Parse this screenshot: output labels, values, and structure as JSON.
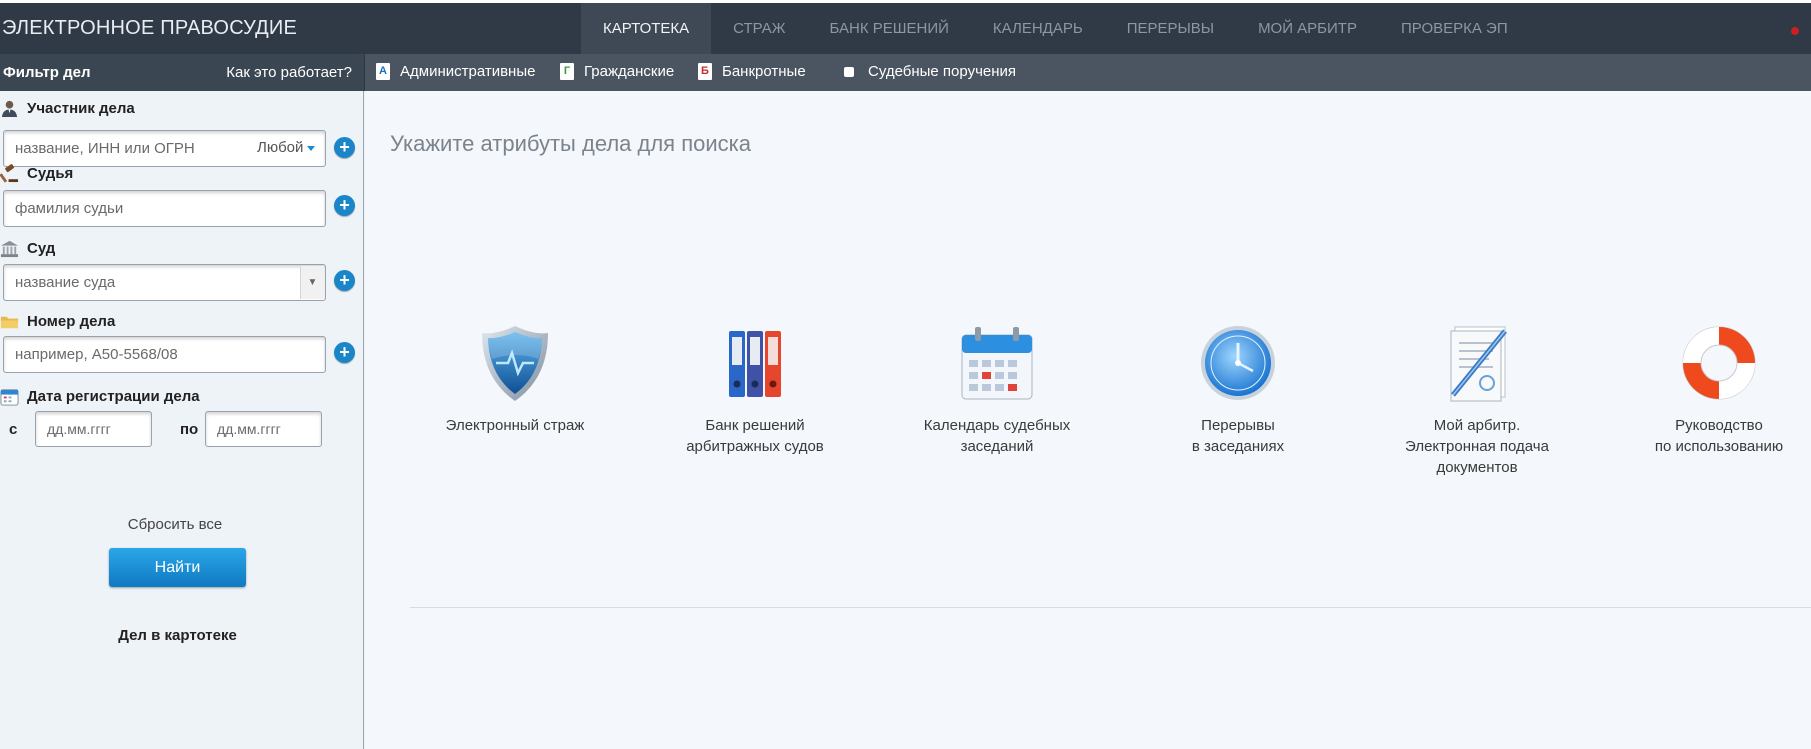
{
  "header": {
    "brand": "ЭЛЕКТРОННОЕ ПРАВОСУДИЕ",
    "nav": [
      "КАРТОТЕКА",
      "СТРАЖ",
      "БАНК РЕШЕНИЙ",
      "КАЛЕНДАРЬ",
      "ПЕРЕРЫВЫ",
      "МОЙ АРБИТР",
      "ПРОВЕРКА ЭП"
    ],
    "active_nav": "КАРТОТЕКА"
  },
  "filter": {
    "title": "Фильтр дел",
    "how_link": "Как это работает?",
    "participant": {
      "label": "Участник дела",
      "placeholder": "название, ИНН или ОГРН",
      "role": "Любой"
    },
    "judge": {
      "label": "Судья",
      "placeholder": "фамилия судьи"
    },
    "court": {
      "label": "Суд",
      "placeholder": "название суда"
    },
    "case_number": {
      "label": "Номер дела",
      "placeholder": "например, А50-5568/08"
    },
    "reg_date": {
      "label": "Дата регистрации дела",
      "from_label": "с",
      "to_label": "по",
      "from_placeholder": "дд.мм.гггг",
      "to_placeholder": "дд.мм.гггг"
    },
    "find_button": "Найти",
    "reset": "Сбросить все",
    "cases_count_label": "Дел в картотеке"
  },
  "case_types": [
    {
      "badge": "А",
      "label": "Административные",
      "color": "#1a6fc0"
    },
    {
      "badge": "Г",
      "label": "Гражданские",
      "color": "#3f9a3a"
    },
    {
      "badge": "Б",
      "label": "Банкротные",
      "color": "#c62d2d"
    },
    {
      "label": "Судебные поручения"
    }
  ],
  "main": {
    "title": "Укажите атрибуты дела для поиска",
    "tiles": [
      {
        "icon": "shield-icon",
        "lines": [
          "Электронный страж"
        ]
      },
      {
        "icon": "binders-icon",
        "lines": [
          "Банк решений",
          "арбитражных судов"
        ]
      },
      {
        "icon": "calendar-icon",
        "lines": [
          "Календарь судебных",
          "заседаний"
        ]
      },
      {
        "icon": "clock-icon",
        "lines": [
          "Перерывы",
          "в заседаниях"
        ]
      },
      {
        "icon": "document-pen-icon",
        "lines": [
          "Мой арбитр.",
          "Электронная подача",
          "документов"
        ]
      },
      {
        "icon": "lifebuoy-icon",
        "lines": [
          "Руководство",
          "по использованию"
        ]
      }
    ]
  }
}
